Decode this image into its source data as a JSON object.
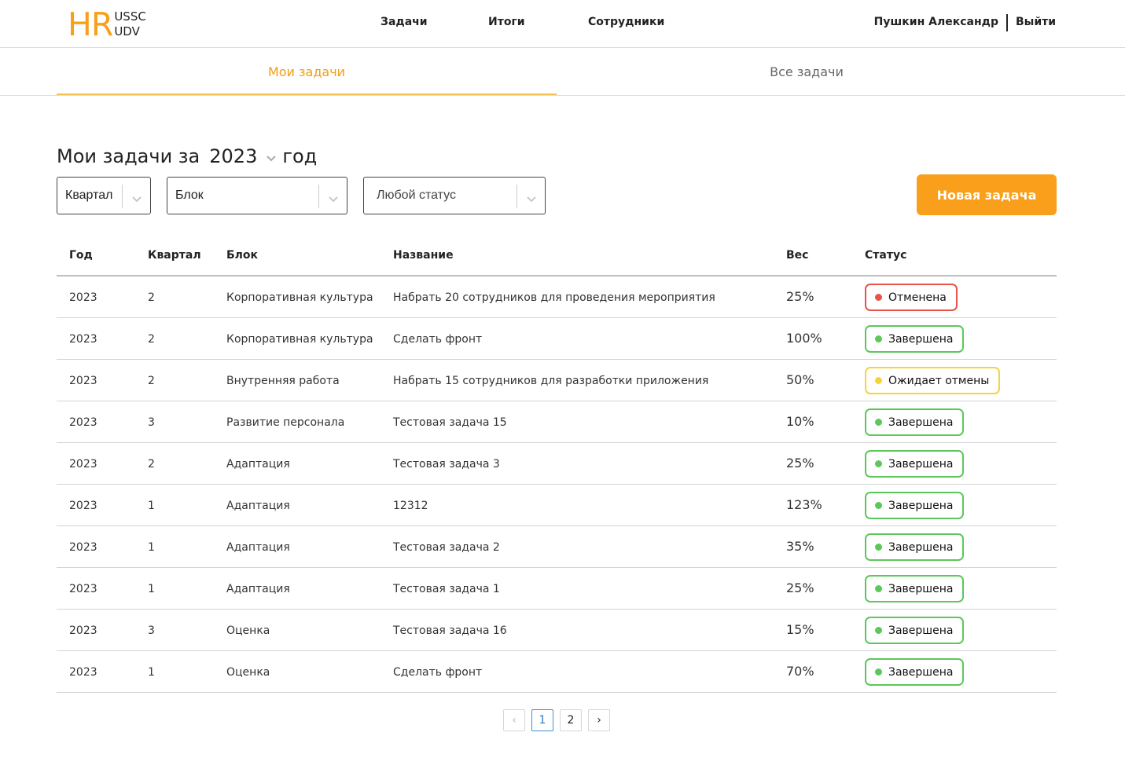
{
  "header": {
    "logo_main": "HR",
    "logo_top": "USSC",
    "logo_bottom": "UDV",
    "nav": [
      "Задачи",
      "Итоги",
      "Сотрудники"
    ],
    "user_name": "Пушкин Александр",
    "logout_label": "Выйти"
  },
  "tabs": {
    "my_tasks": "Мои задачи",
    "all_tasks": "Все задачи",
    "active": "my_tasks"
  },
  "title": {
    "prefix": "Мои задачи за",
    "year": "2023",
    "suffix": "год"
  },
  "filters": {
    "quarter": "Квартал",
    "block": "Блок",
    "status": "Любой статус"
  },
  "new_task_label": "Новая задача",
  "colors": {
    "accent": "#f99f1b",
    "status_cancelled": "#e8534a",
    "status_done": "#5cc85a",
    "status_pending": "#f5d33d"
  },
  "table": {
    "headers": [
      "Год",
      "Квартал",
      "Блок",
      "Название",
      "Вес",
      "Статус"
    ],
    "rows": [
      {
        "year": "2023",
        "quarter": "2",
        "block": "Корпоративная культура",
        "name": "Набрать 20 сотрудников для проведения мероприятия",
        "weight": "25%",
        "status": "Отменена",
        "status_kind": "cancelled"
      },
      {
        "year": "2023",
        "quarter": "2",
        "block": "Корпоративная культура",
        "name": "Сделать фронт",
        "weight": "100%",
        "status": "Завершена",
        "status_kind": "done"
      },
      {
        "year": "2023",
        "quarter": "2",
        "block": "Внутренняя работа",
        "name": "Набрать 15 сотрудников для разработки приложения",
        "weight": "50%",
        "status": "Ожидает отмены",
        "status_kind": "pending"
      },
      {
        "year": "2023",
        "quarter": "3",
        "block": "Развитие персонала",
        "name": "Тестовая задача 15",
        "weight": "10%",
        "status": "Завершена",
        "status_kind": "done"
      },
      {
        "year": "2023",
        "quarter": "2",
        "block": "Адаптация",
        "name": "Тестовая задача 3",
        "weight": "25%",
        "status": "Завершена",
        "status_kind": "done"
      },
      {
        "year": "2023",
        "quarter": "1",
        "block": "Адаптация",
        "name": "12312",
        "weight": "123%",
        "status": "Завершена",
        "status_kind": "done"
      },
      {
        "year": "2023",
        "quarter": "1",
        "block": "Адаптация",
        "name": "Тестовая задача 2",
        "weight": "35%",
        "status": "Завершена",
        "status_kind": "done"
      },
      {
        "year": "2023",
        "quarter": "1",
        "block": "Адаптация",
        "name": "Тестовая задача 1",
        "weight": "25%",
        "status": "Завершена",
        "status_kind": "done"
      },
      {
        "year": "2023",
        "quarter": "3",
        "block": "Оценка",
        "name": "Тестовая задача 16",
        "weight": "15%",
        "status": "Завершена",
        "status_kind": "done"
      },
      {
        "year": "2023",
        "quarter": "1",
        "block": "Оценка",
        "name": "Сделать фронт",
        "weight": "70%",
        "status": "Завершена",
        "status_kind": "done"
      }
    ]
  },
  "pagination": {
    "prev": "‹",
    "pages": [
      "1",
      "2"
    ],
    "current": "1",
    "next": "›"
  }
}
